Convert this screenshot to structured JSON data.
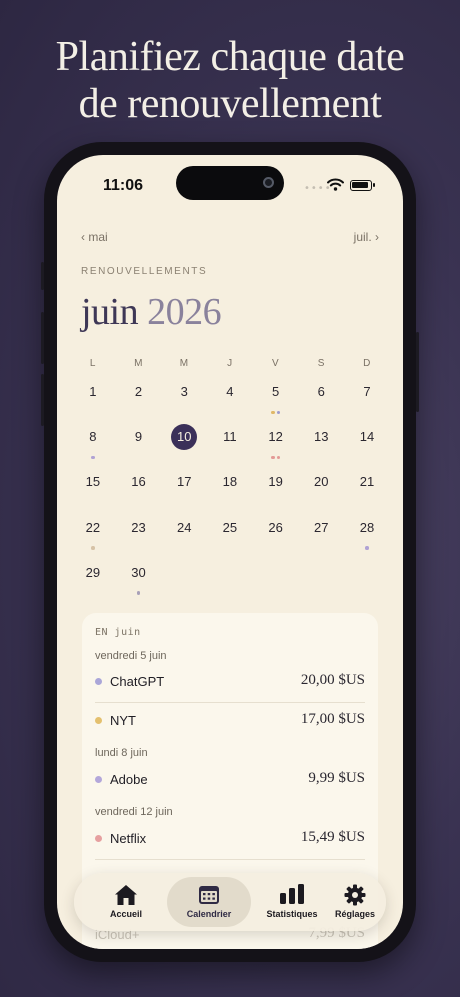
{
  "headline": {
    "line1": "Planifiez chaque date",
    "line2": "de renouvellement"
  },
  "status": {
    "time": "11:06"
  },
  "nav": {
    "prev": "‹ mai",
    "next": "juil. ›"
  },
  "section_label": "RENOUVELLEMENTS",
  "month": {
    "name": "juin",
    "year": "2026"
  },
  "weekdays": [
    "L",
    "M",
    "M",
    "J",
    "V",
    "S",
    "D"
  ],
  "calendar": {
    "days": [
      {
        "n": "1"
      },
      {
        "n": "2"
      },
      {
        "n": "3"
      },
      {
        "n": "4"
      },
      {
        "n": "5",
        "dots": [
          "#e0b868",
          "#9c9ad0"
        ]
      },
      {
        "n": "6"
      },
      {
        "n": "7"
      },
      {
        "n": "8",
        "dots": [
          "#b0a2d4"
        ]
      },
      {
        "n": "9"
      },
      {
        "n": "10",
        "selected": true
      },
      {
        "n": "11"
      },
      {
        "n": "12",
        "dots": [
          "#e39a96",
          "#e39a96"
        ]
      },
      {
        "n": "13"
      },
      {
        "n": "14"
      },
      {
        "n": "15"
      },
      {
        "n": "16"
      },
      {
        "n": "17"
      },
      {
        "n": "18"
      },
      {
        "n": "19"
      },
      {
        "n": "20"
      },
      {
        "n": "21"
      },
      {
        "n": "22",
        "dots": [
          "#d6c2a6"
        ]
      },
      {
        "n": "23"
      },
      {
        "n": "24"
      },
      {
        "n": "25"
      },
      {
        "n": "26"
      },
      {
        "n": "27"
      },
      {
        "n": "28",
        "dots": [
          "#b0a2d4"
        ]
      },
      {
        "n": "29"
      },
      {
        "n": "30",
        "dots": [
          "#a8a0b8"
        ]
      }
    ]
  },
  "list": {
    "header": "EN juin",
    "groups": [
      {
        "date": "vendredi 5 juin",
        "items": [
          {
            "name": "ChatGPT",
            "price": "20,00 $US",
            "color": "#aaa6d8"
          },
          {
            "name": "NYT",
            "price": "17,00 $US",
            "color": "#e4c06e"
          }
        ]
      },
      {
        "date": "lundi 8 juin",
        "items": [
          {
            "name": "Adobe",
            "price": "9,99 $US",
            "color": "#b3a7da"
          }
        ]
      },
      {
        "date": "vendredi 12 juin",
        "items": [
          {
            "name": "Netflix",
            "price": "15,49 $US",
            "color": "#e6a0a0"
          }
        ]
      }
    ],
    "peek": {
      "name": "iCloud+",
      "price": "7,99 $US"
    }
  },
  "tabs": [
    {
      "label": "Accueil",
      "icon": "home-icon"
    },
    {
      "label": "Calendrier",
      "icon": "calendar-icon",
      "active": true
    },
    {
      "label": "Statistiques",
      "icon": "bar-chart-icon"
    },
    {
      "label": "Réglages",
      "icon": "gear-icon"
    }
  ],
  "colors": {
    "accent": "#3b3059",
    "screen_bg": "#f6efdf",
    "page_bg": "#3a3352"
  }
}
